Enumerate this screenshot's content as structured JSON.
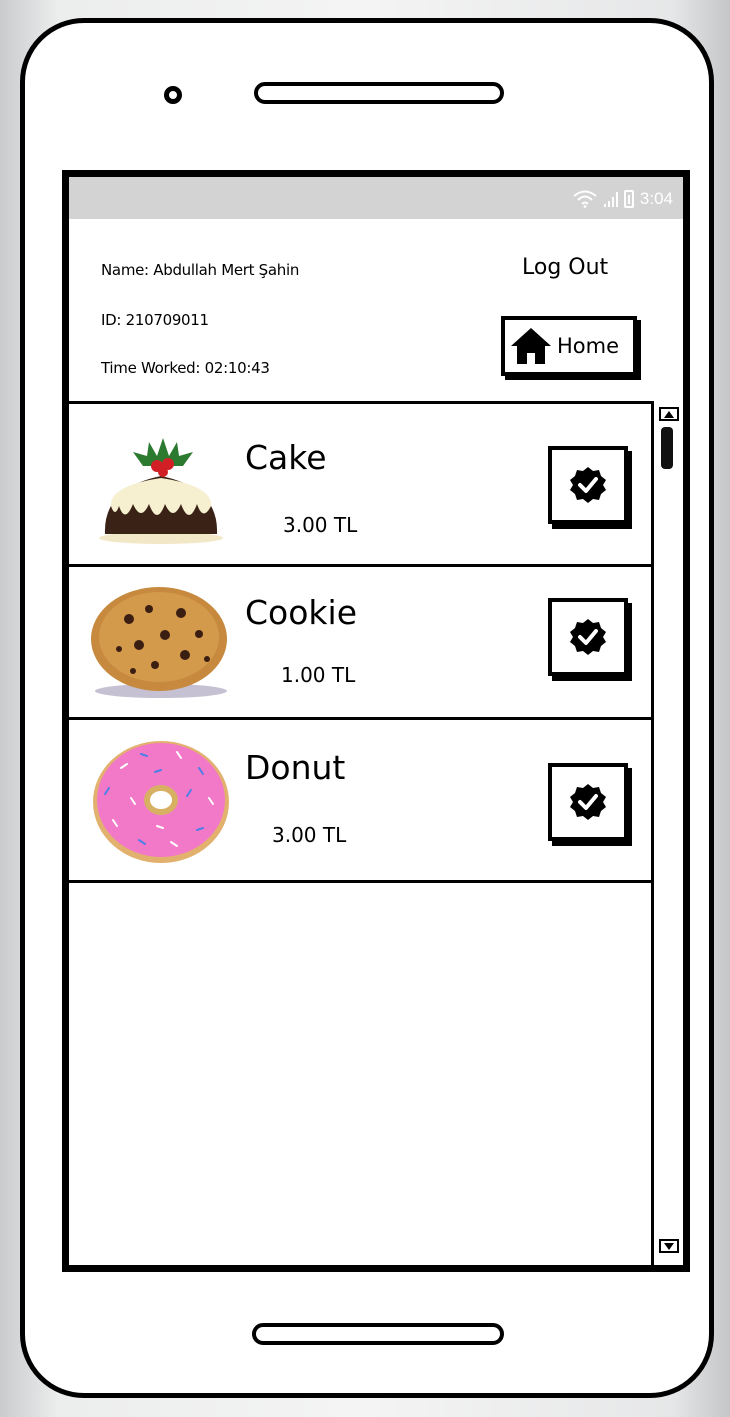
{
  "status_bar": {
    "time": "3:04",
    "icons": [
      "wifi-icon",
      "signal-icon",
      "battery-icon"
    ]
  },
  "user": {
    "name": "Name: Abdullah Mert Şahin",
    "id": "ID: 210709011",
    "time_worked": "Time Worked: 02:10:43"
  },
  "header": {
    "logout_label": "Log Out",
    "home_label": "Home",
    "home_icon": "home-icon"
  },
  "products": [
    {
      "name": "Cake",
      "price": "3.00 TL",
      "image": "cake-image",
      "action_icon": "check-badge-icon"
    },
    {
      "name": "Cookie",
      "price": "1.00 TL",
      "image": "cookie-image",
      "action_icon": "check-badge-icon"
    },
    {
      "name": "Donut",
      "price": "3.00 TL",
      "image": "donut-image",
      "action_icon": "check-badge-icon"
    }
  ],
  "colors": {
    "frame": "#000000",
    "status_bar": "#d3d3d3",
    "screen_bg": "#ffffff",
    "donut_frosting": "#f278c8",
    "cake_brown": "#3a2216",
    "cookie": "#c7893e"
  }
}
